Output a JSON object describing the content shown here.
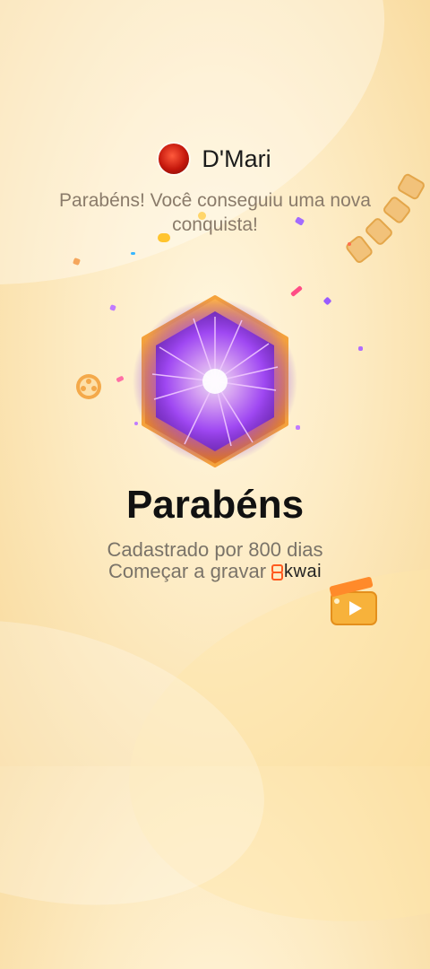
{
  "profile": {
    "name": "D'Mari"
  },
  "message": "Parabéns! Você conseguiu uma nova conquista!",
  "achievement": {
    "title": "Parabéns",
    "description": "Cadastrado por 800 dias",
    "cta": "Começar a gravar",
    "brand": "kwai"
  },
  "colors": {
    "accent": "#ff5a1f",
    "badge_glow": "#c15cff",
    "background": "#fdebc3"
  }
}
